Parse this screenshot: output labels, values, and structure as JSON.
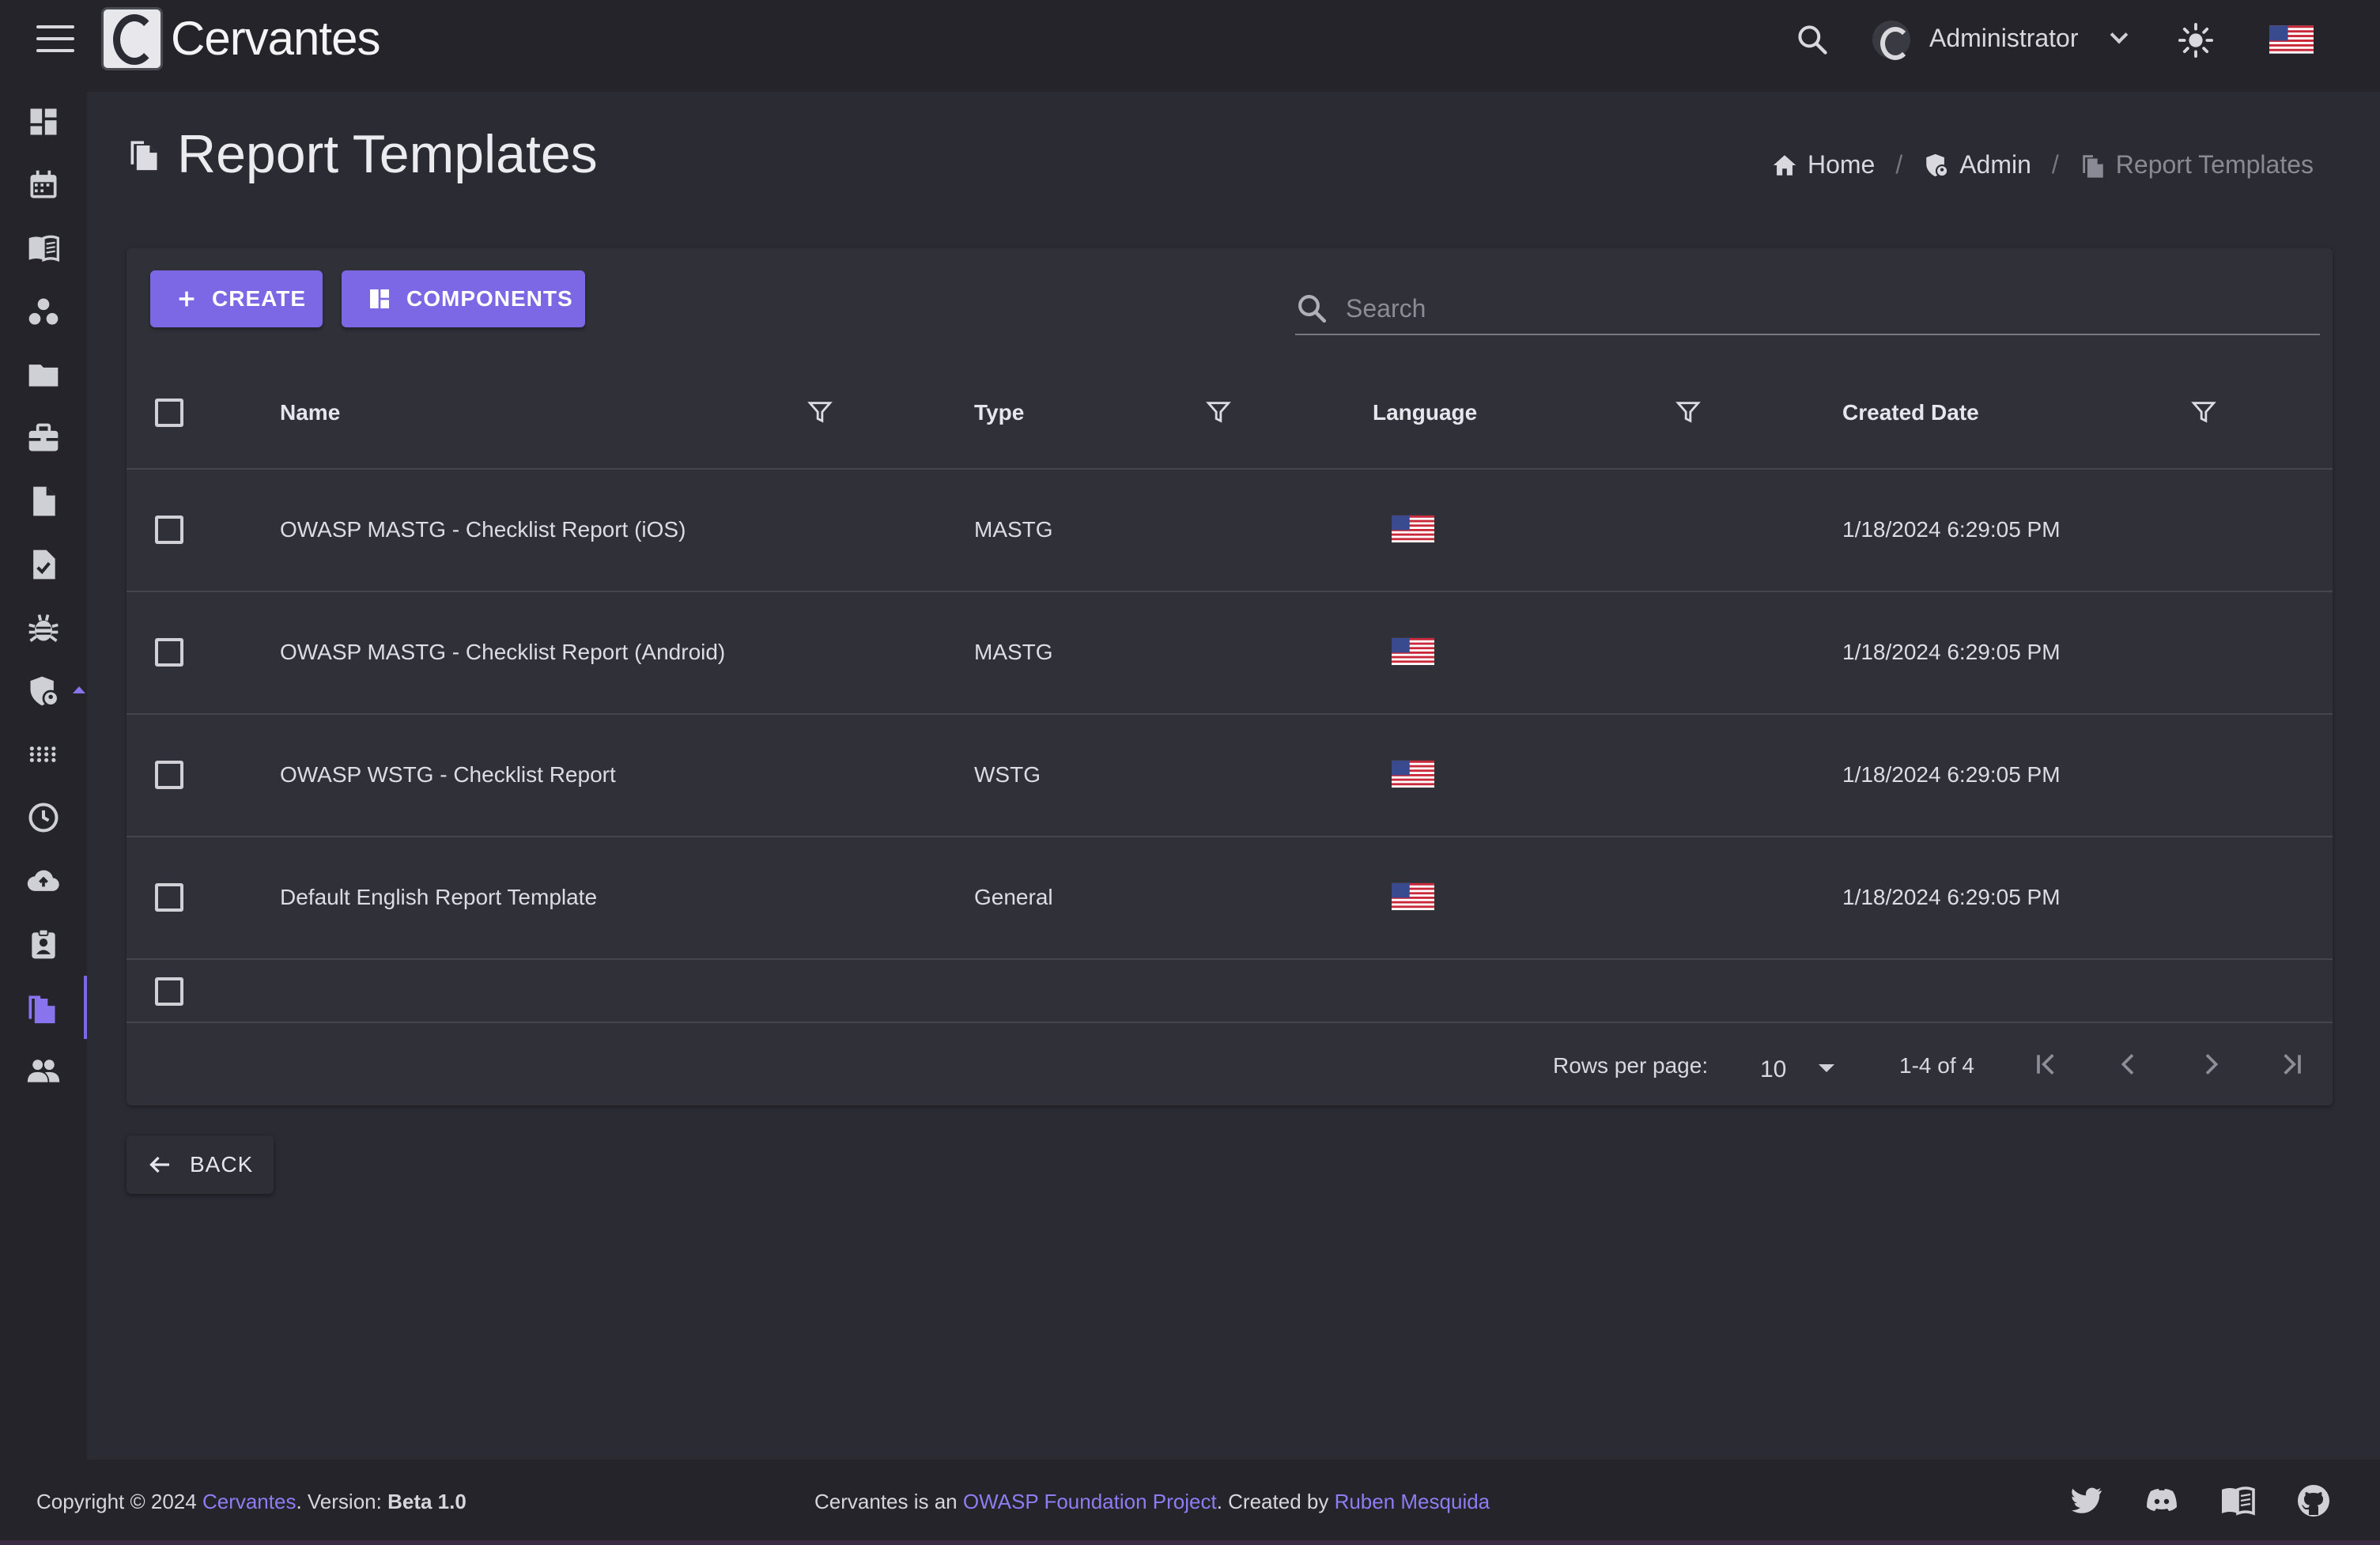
{
  "app": {
    "title": "Cervantes"
  },
  "topbar": {
    "user_name": "Administrator",
    "icons": [
      "menu-icon",
      "search-icon",
      "user-logo-icon",
      "chevron-down-icon",
      "theme-sun-icon",
      "us-flag-icon"
    ]
  },
  "sidebar": {
    "items": [
      {
        "icon": "dashboard-icon"
      },
      {
        "icon": "calendar-icon"
      },
      {
        "icon": "book-icon"
      },
      {
        "icon": "clients-icon"
      },
      {
        "icon": "folder-icon"
      },
      {
        "icon": "briefcase-icon"
      },
      {
        "icon": "document-icon"
      },
      {
        "icon": "document-check-icon"
      },
      {
        "icon": "bug-icon"
      },
      {
        "icon": "admin-shield-icon"
      },
      {
        "icon": "apps-grid-icon"
      },
      {
        "icon": "clock-icon"
      },
      {
        "icon": "cloud-upload-icon"
      },
      {
        "icon": "contact-badge-icon"
      },
      {
        "icon": "report-templates-icon",
        "active": true
      },
      {
        "icon": "people-icon"
      }
    ]
  },
  "page": {
    "title": "Report Templates",
    "breadcrumb": [
      {
        "label": "Home",
        "icon": "home-icon"
      },
      {
        "label": "Admin",
        "icon": "admin-icon"
      },
      {
        "label": "Report Templates",
        "icon": "report-templates-icon"
      }
    ]
  },
  "toolbar": {
    "create_label": "CREATE",
    "components_label": "COMPONENTS",
    "search_placeholder": "Search"
  },
  "table": {
    "columns": [
      "Name",
      "Type",
      "Language",
      "Created Date"
    ],
    "rows": [
      {
        "name": "OWASP MASTG - Checklist Report (iOS)",
        "type": "MASTG",
        "language": "en-US flag",
        "created": "1/18/2024 6:29:05 PM"
      },
      {
        "name": "OWASP MASTG - Checklist Report (Android)",
        "type": "MASTG",
        "language": "en-US flag",
        "created": "1/18/2024 6:29:05 PM"
      },
      {
        "name": "OWASP WSTG - Checklist Report",
        "type": "WSTG",
        "language": "en-US flag",
        "created": "1/18/2024 6:29:05 PM"
      },
      {
        "name": "Default English Report Template",
        "type": "General",
        "language": "en-US flag",
        "created": "1/18/2024 6:29:05 PM"
      }
    ],
    "pagination": {
      "rows_per_page_label": "Rows per page:",
      "rows_per_page": "10",
      "range": "1-4 of 4"
    }
  },
  "back_label": "BACK",
  "footer": {
    "copyright_prefix": "Copyright © 2024 ",
    "app_link": "Cervantes",
    "version_prefix": ". Version: ",
    "version": "Beta 1.0",
    "center_prefix": "Cervantes is an ",
    "owasp_link": "OWASP Foundation Project",
    "created_by": ". Created by ",
    "author_link": "Ruben Mesquida",
    "icons": [
      "twitter-icon",
      "discord-icon",
      "docs-book-icon",
      "github-icon"
    ]
  },
  "colors": {
    "accent": "#7c67e4",
    "link": "#8e7cf2",
    "background": "#2b2b33",
    "surface": "#303039",
    "bar": "#24242a"
  }
}
